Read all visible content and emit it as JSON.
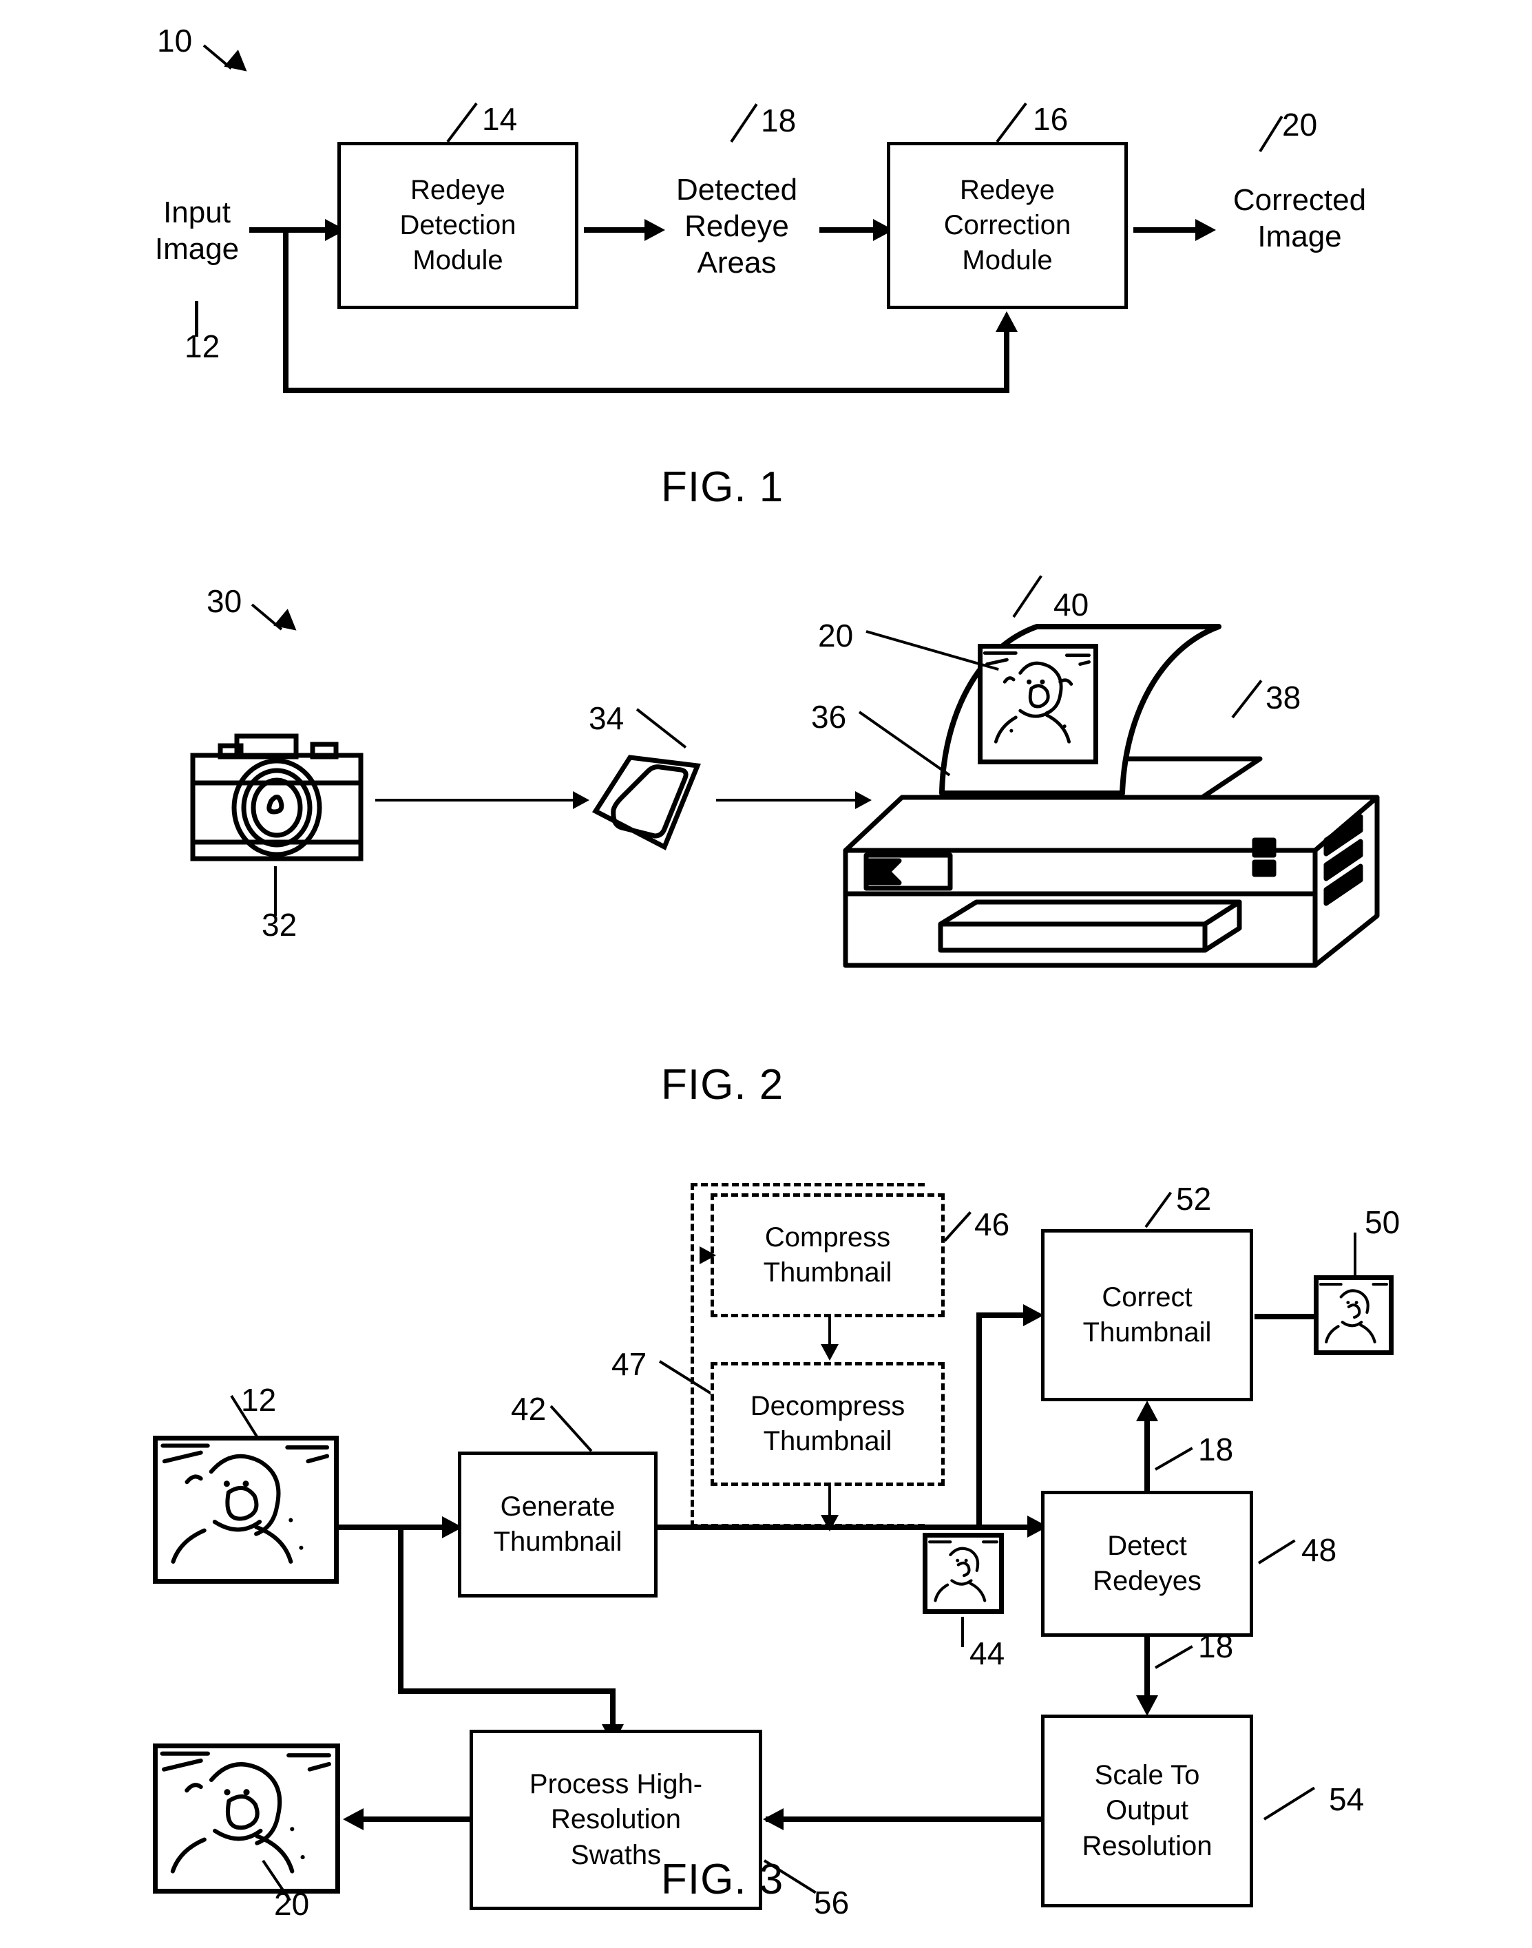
{
  "figures": [
    {
      "id": "fig1",
      "caption": "FIG. 1",
      "system_ref": "10",
      "nodes": {
        "input_image": "Input\nImage",
        "redeye_detection_module": "Redeye\nDetection\nModule",
        "detected_redeye_areas": "Detected\nRedeye\nAreas",
        "redeye_correction_module": "Redeye\nCorrection\nModule",
        "corrected_image": "Corrected\nImage"
      },
      "refs": {
        "input_image": "12",
        "detection_module": "14",
        "correction_module": "16",
        "detected_areas": "18",
        "corrected_image": "20"
      }
    },
    {
      "id": "fig2",
      "caption": "FIG. 2",
      "system_ref": "30",
      "refs": {
        "camera": "32",
        "memory_card": "34",
        "card_slot": "36",
        "printer": "38",
        "print_medium": "40",
        "corrected_image": "20"
      }
    },
    {
      "id": "fig3",
      "caption": "FIG. 3",
      "nodes": {
        "compress_thumbnail": "Compress\nThumbnail",
        "decompress_thumbnail": "Decompress\nThumbnail",
        "generate_thumbnail": "Generate\nThumbnail",
        "correct_thumbnail": "Correct\nThumbnail",
        "detect_redeyes": "Detect\nRedeyes",
        "scale_to_output_resolution": "Scale To\nOutput\nResolution",
        "process_high_resolution_swaths": "Process High-\nResolution\nSwaths"
      },
      "refs": {
        "input_image": "12",
        "generate_thumbnail": "42",
        "thumbnail": "44",
        "compress_thumbnail": "46",
        "optional_group": "47",
        "detect_redeyes": "48",
        "corrected_thumbnail": "50",
        "correct_thumbnail": "52",
        "scale_to_output": "54",
        "process_swaths": "56",
        "detected_areas_a": "18",
        "detected_areas_b": "18",
        "corrected_image": "20"
      }
    }
  ]
}
